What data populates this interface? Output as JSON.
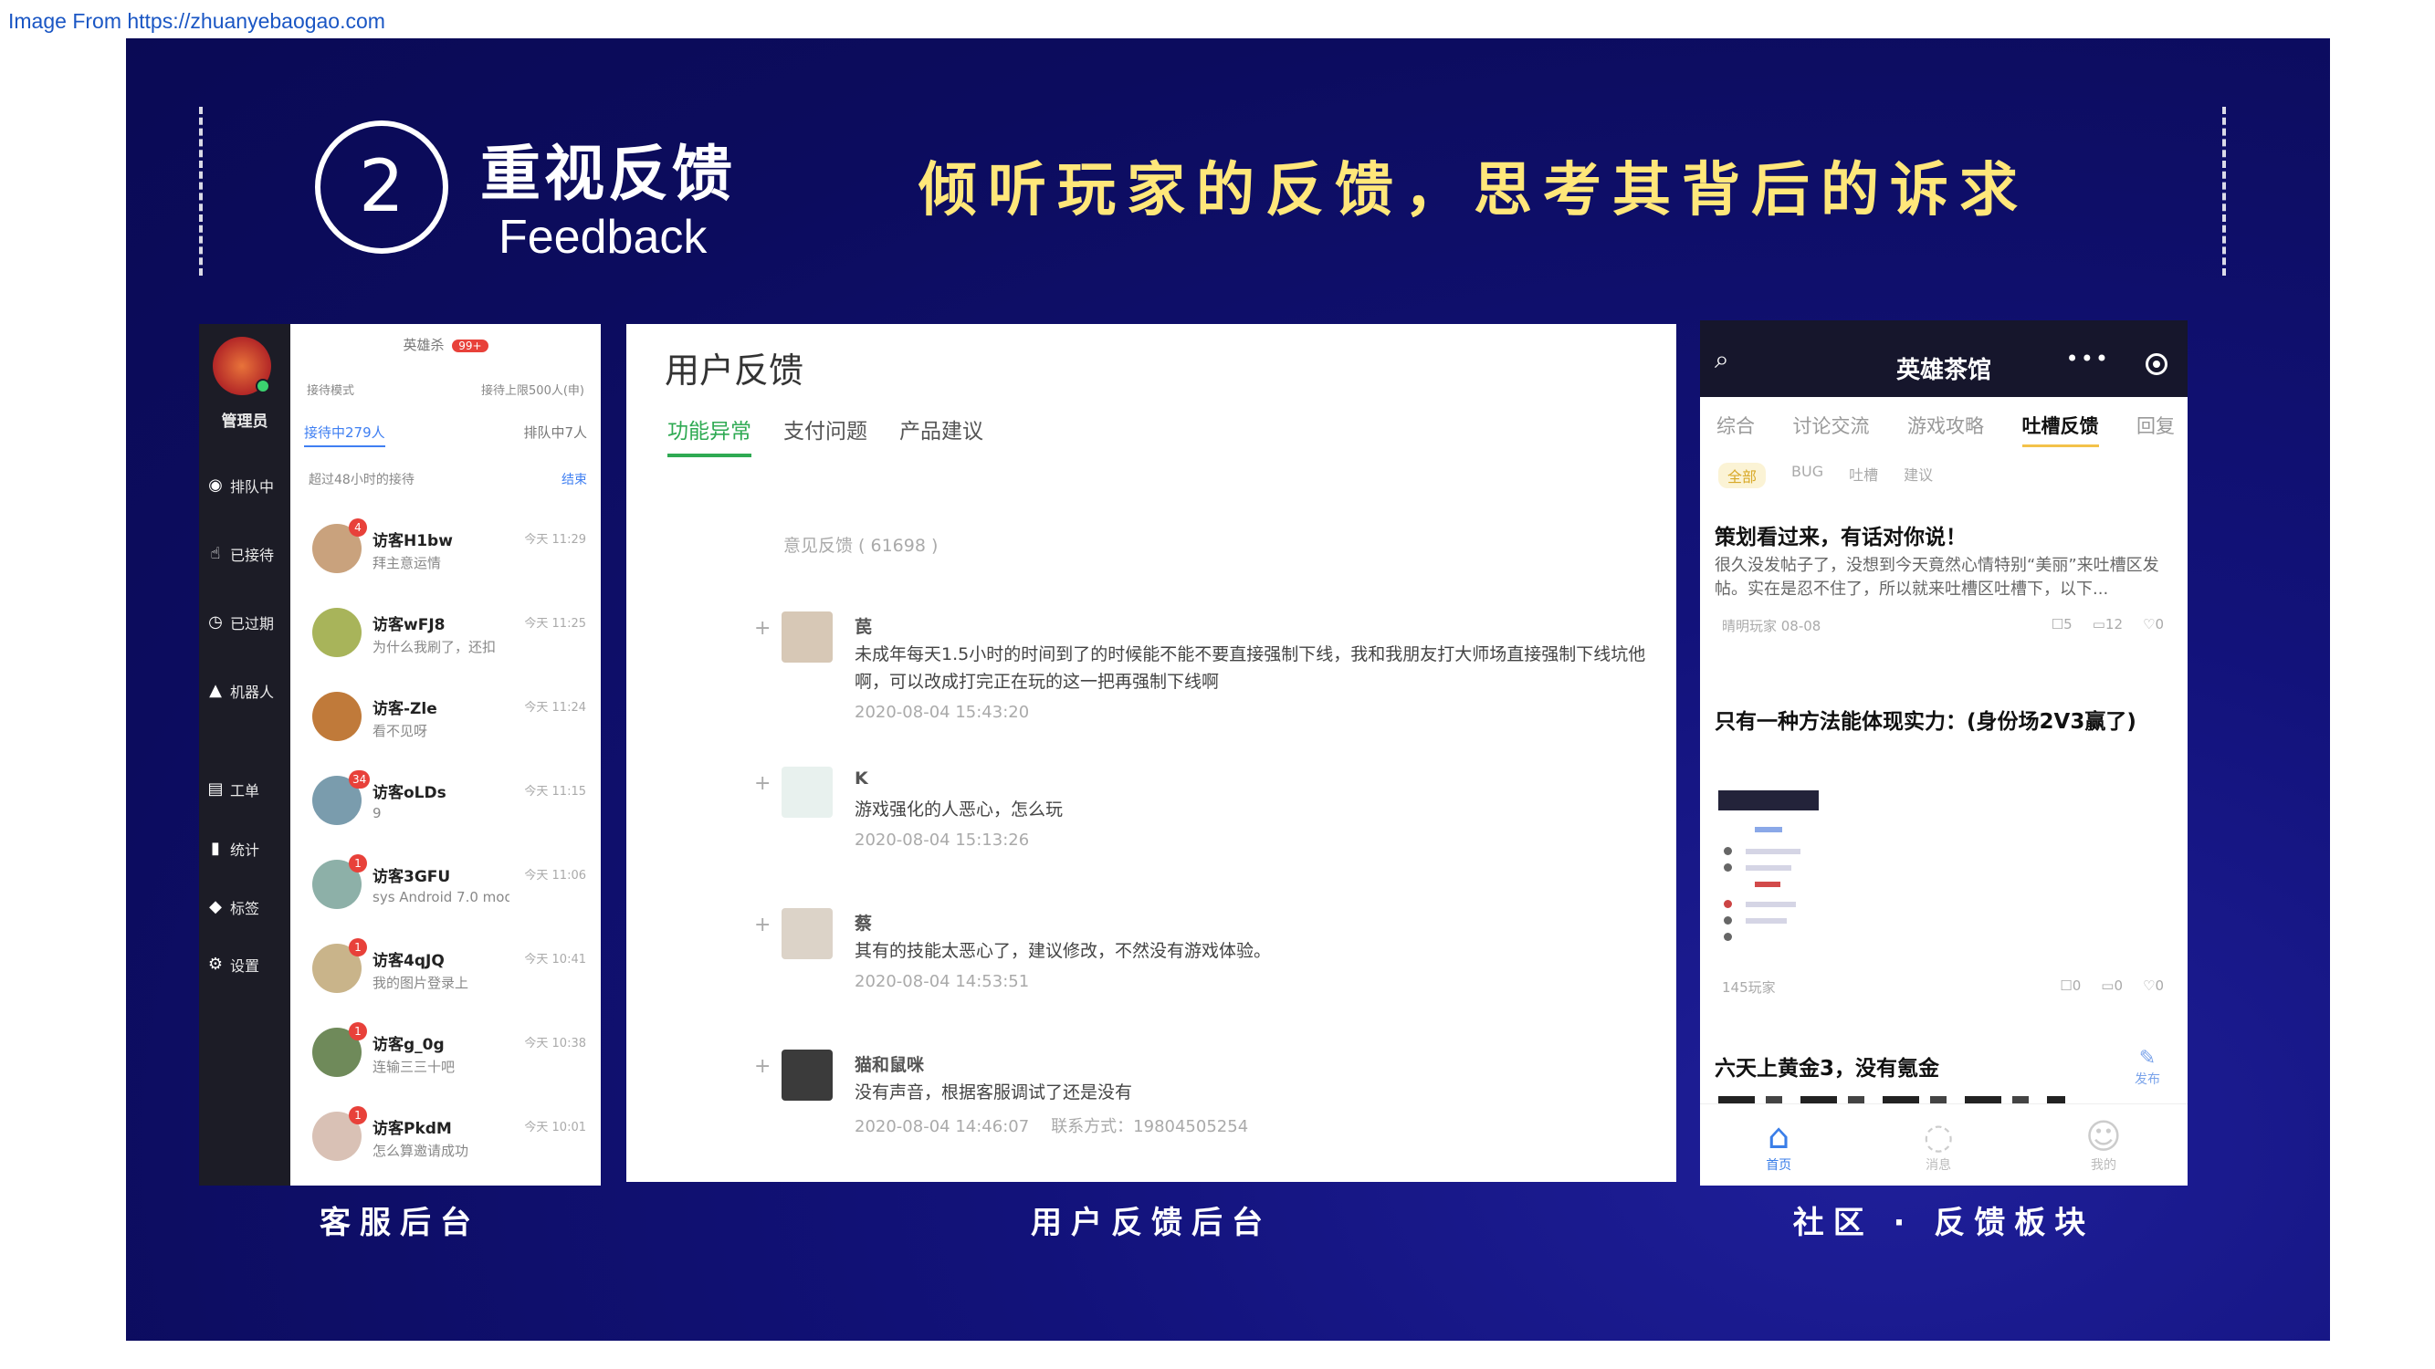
{
  "source_label": "Image From https://zhuanyebaogao.com",
  "header": {
    "number": "2",
    "title_cn": "重视反馈",
    "title_en": "Feedback",
    "slogan": "倾听玩家的反馈，思考其背后的诉求"
  },
  "captions": {
    "cs_backend": "客服后台",
    "feedback_backend": "用户反馈后台",
    "community": "社区 · 反馈板块"
  },
  "cs_panel": {
    "role": "管理员",
    "nav": [
      {
        "icon": "headset-icon",
        "label": "排队中"
      },
      {
        "icon": "thumbs-up-icon",
        "label": "已接待"
      },
      {
        "icon": "clock-icon",
        "label": "已过期"
      },
      {
        "icon": "robot-icon",
        "label": "机器人"
      },
      {
        "icon": "ticket-icon",
        "label": "工单"
      },
      {
        "icon": "bar-chart-icon",
        "label": "统计"
      },
      {
        "icon": "tag-icon",
        "label": "标签"
      },
      {
        "icon": "gear-icon",
        "label": "设置"
      }
    ],
    "top_label": "英雄杀",
    "top_badge": "99+",
    "mode_left": "接待模式",
    "mode_right": "接待上限500人(申)",
    "tab_active": "接待中279人",
    "tab_other": "排队中7人",
    "filter_label": "超过48小时的接待",
    "filter_link": "结束",
    "visitors": [
      {
        "name": "访客H1bw",
        "msg": "拜主意运情",
        "time": "今天 11:29",
        "badge": "4",
        "color": "#c9a27d"
      },
      {
        "name": "访客wFJ8",
        "msg": "为什么我刷了，还扣",
        "time": "今天 11:25",
        "badge": "",
        "color": "#a8b45a"
      },
      {
        "name": "访客-Zle",
        "msg": "看不见呀",
        "time": "今天 11:24",
        "badge": "",
        "color": "#c07a3a"
      },
      {
        "name": "访客oLDs",
        "msg": "9",
        "time": "今天 11:15",
        "badge": "34",
        "color": "#7a9cad"
      },
      {
        "name": "访客3GFU",
        "msg": "sys Android 7.0 mode",
        "time": "今天 11:06",
        "badge": "1",
        "color": "#8db0a8"
      },
      {
        "name": "访客4qJQ",
        "msg": "我的图片登录上",
        "time": "今天 10:41",
        "badge": "1",
        "color": "#c9b48a"
      },
      {
        "name": "访客g_0g",
        "msg": "连输三三十吧",
        "time": "今天 10:38",
        "badge": "1",
        "color": "#6f8a5a"
      },
      {
        "name": "访客PkdM",
        "msg": "怎么算邀请成功",
        "time": "今天 10:01",
        "badge": "1",
        "color": "#d9c1b5"
      }
    ]
  },
  "feedback_panel": {
    "title": "用户反馈",
    "tabs": [
      "功能异常",
      "支付问题",
      "产品建议"
    ],
    "section_label": "意见反馈 ( 61698 )",
    "items": [
      {
        "name": "苠",
        "text": "未成年每天1.5小时的时间到了的时候能不能不要直接强制下线，我和我朋友打大师场直接强制下线坑他啊，可以改成打完正在玩的这一把再强制下线啊",
        "time": "2020-08-04 15:43:20",
        "contact": "",
        "color": "#d7c8b6"
      },
      {
        "name": "K",
        "text": "游戏强化的人恶心，怎么玩",
        "time": "2020-08-04 15:13:26",
        "contact": "",
        "color": "#e8f1ee"
      },
      {
        "name": "蔡",
        "text": "其有的技能太恶心了，建议修改，不然没有游戏体验。",
        "time": "2020-08-04 14:53:51",
        "contact": "",
        "color": "#dcd3c8"
      },
      {
        "name": "猫和鼠咪",
        "text": "没有声音，根据客服调试了还是没有",
        "time": "2020-08-04 14:46:07",
        "contact": "联系方式：19804505254",
        "color": "#3b3b3b"
      }
    ]
  },
  "community_panel": {
    "title": "英雄茶馆",
    "more": "•••",
    "tabs": [
      "综合",
      "讨论交流",
      "游戏攻略",
      "吐槽反馈",
      "回复"
    ],
    "chips": [
      "全部",
      "BUG",
      "吐槽",
      "建议"
    ],
    "post1": {
      "title": "策划看过来，有话对你说！",
      "body": "很久没发帖子了，没想到今天竟然心情特别“美丽”来吐槽区发帖。实在是忍不住了，所以就来吐槽区吐槽下，以下...",
      "author": "晴明玩家 08-08",
      "views": "5",
      "comments": "12",
      "likes": "0"
    },
    "post2": {
      "title": "只有一种方法能体现实力：(身份场2V3赢了)",
      "author": "145玩家",
      "views": "0",
      "comments": "0",
      "likes": "0"
    },
    "post3": {
      "title": "六天上黄金3，没有氪金",
      "action": "发布"
    },
    "tabbar": [
      "首页",
      "消息",
      "我的"
    ]
  }
}
